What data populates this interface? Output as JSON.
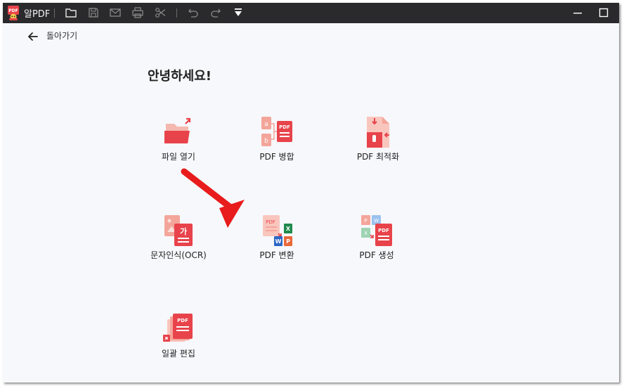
{
  "window": {
    "app_name": "알PDF",
    "toolbar_icons": [
      "folder-icon",
      "save-icon",
      "mail-icon",
      "print-icon",
      "scissors-icon",
      "undo-icon",
      "redo-icon",
      "dropdown-icon"
    ]
  },
  "nav": {
    "back_label": "돌아가기"
  },
  "main": {
    "greeting": "안녕하세요!",
    "tiles": [
      {
        "label": "파일 열기",
        "icon": "open-file-icon"
      },
      {
        "label": "PDF 병합",
        "icon": "merge-pdf-icon"
      },
      {
        "label": "PDF 최적화",
        "icon": "optimize-pdf-icon"
      },
      {
        "label": "문자인식(OCR)",
        "icon": "ocr-icon"
      },
      {
        "label": "PDF 변환",
        "icon": "convert-pdf-icon"
      },
      {
        "label": "PDF 생성",
        "icon": "create-pdf-icon"
      },
      {
        "label": "일괄 편집",
        "icon": "batch-edit-icon"
      }
    ]
  },
  "colors": {
    "accent": "#e8434b",
    "light_accent": "#f4a59a",
    "titlebar": "#2a2a2c",
    "annotation_arrow": "#e81c1c"
  }
}
